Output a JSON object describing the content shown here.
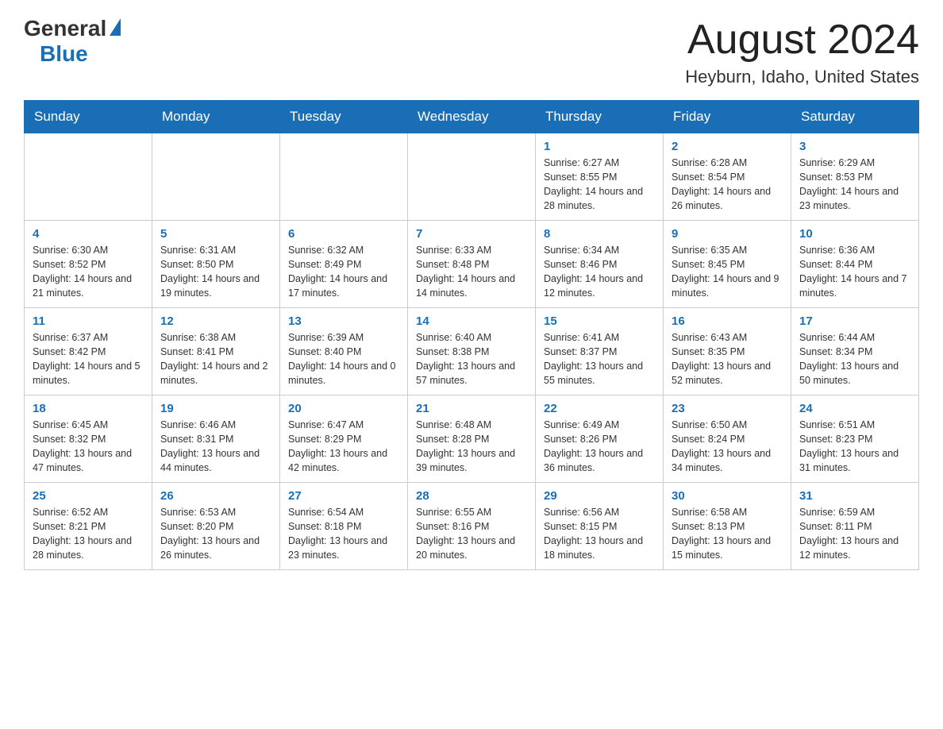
{
  "header": {
    "logo_general": "General",
    "logo_blue": "Blue",
    "month_title": "August 2024",
    "location": "Heyburn, Idaho, United States"
  },
  "weekdays": [
    "Sunday",
    "Monday",
    "Tuesday",
    "Wednesday",
    "Thursday",
    "Friday",
    "Saturday"
  ],
  "weeks": [
    [
      {
        "day": "",
        "info": ""
      },
      {
        "day": "",
        "info": ""
      },
      {
        "day": "",
        "info": ""
      },
      {
        "day": "",
        "info": ""
      },
      {
        "day": "1",
        "info": "Sunrise: 6:27 AM\nSunset: 8:55 PM\nDaylight: 14 hours and 28 minutes."
      },
      {
        "day": "2",
        "info": "Sunrise: 6:28 AM\nSunset: 8:54 PM\nDaylight: 14 hours and 26 minutes."
      },
      {
        "day": "3",
        "info": "Sunrise: 6:29 AM\nSunset: 8:53 PM\nDaylight: 14 hours and 23 minutes."
      }
    ],
    [
      {
        "day": "4",
        "info": "Sunrise: 6:30 AM\nSunset: 8:52 PM\nDaylight: 14 hours and 21 minutes."
      },
      {
        "day": "5",
        "info": "Sunrise: 6:31 AM\nSunset: 8:50 PM\nDaylight: 14 hours and 19 minutes."
      },
      {
        "day": "6",
        "info": "Sunrise: 6:32 AM\nSunset: 8:49 PM\nDaylight: 14 hours and 17 minutes."
      },
      {
        "day": "7",
        "info": "Sunrise: 6:33 AM\nSunset: 8:48 PM\nDaylight: 14 hours and 14 minutes."
      },
      {
        "day": "8",
        "info": "Sunrise: 6:34 AM\nSunset: 8:46 PM\nDaylight: 14 hours and 12 minutes."
      },
      {
        "day": "9",
        "info": "Sunrise: 6:35 AM\nSunset: 8:45 PM\nDaylight: 14 hours and 9 minutes."
      },
      {
        "day": "10",
        "info": "Sunrise: 6:36 AM\nSunset: 8:44 PM\nDaylight: 14 hours and 7 minutes."
      }
    ],
    [
      {
        "day": "11",
        "info": "Sunrise: 6:37 AM\nSunset: 8:42 PM\nDaylight: 14 hours and 5 minutes."
      },
      {
        "day": "12",
        "info": "Sunrise: 6:38 AM\nSunset: 8:41 PM\nDaylight: 14 hours and 2 minutes."
      },
      {
        "day": "13",
        "info": "Sunrise: 6:39 AM\nSunset: 8:40 PM\nDaylight: 14 hours and 0 minutes."
      },
      {
        "day": "14",
        "info": "Sunrise: 6:40 AM\nSunset: 8:38 PM\nDaylight: 13 hours and 57 minutes."
      },
      {
        "day": "15",
        "info": "Sunrise: 6:41 AM\nSunset: 8:37 PM\nDaylight: 13 hours and 55 minutes."
      },
      {
        "day": "16",
        "info": "Sunrise: 6:43 AM\nSunset: 8:35 PM\nDaylight: 13 hours and 52 minutes."
      },
      {
        "day": "17",
        "info": "Sunrise: 6:44 AM\nSunset: 8:34 PM\nDaylight: 13 hours and 50 minutes."
      }
    ],
    [
      {
        "day": "18",
        "info": "Sunrise: 6:45 AM\nSunset: 8:32 PM\nDaylight: 13 hours and 47 minutes."
      },
      {
        "day": "19",
        "info": "Sunrise: 6:46 AM\nSunset: 8:31 PM\nDaylight: 13 hours and 44 minutes."
      },
      {
        "day": "20",
        "info": "Sunrise: 6:47 AM\nSunset: 8:29 PM\nDaylight: 13 hours and 42 minutes."
      },
      {
        "day": "21",
        "info": "Sunrise: 6:48 AM\nSunset: 8:28 PM\nDaylight: 13 hours and 39 minutes."
      },
      {
        "day": "22",
        "info": "Sunrise: 6:49 AM\nSunset: 8:26 PM\nDaylight: 13 hours and 36 minutes."
      },
      {
        "day": "23",
        "info": "Sunrise: 6:50 AM\nSunset: 8:24 PM\nDaylight: 13 hours and 34 minutes."
      },
      {
        "day": "24",
        "info": "Sunrise: 6:51 AM\nSunset: 8:23 PM\nDaylight: 13 hours and 31 minutes."
      }
    ],
    [
      {
        "day": "25",
        "info": "Sunrise: 6:52 AM\nSunset: 8:21 PM\nDaylight: 13 hours and 28 minutes."
      },
      {
        "day": "26",
        "info": "Sunrise: 6:53 AM\nSunset: 8:20 PM\nDaylight: 13 hours and 26 minutes."
      },
      {
        "day": "27",
        "info": "Sunrise: 6:54 AM\nSunset: 8:18 PM\nDaylight: 13 hours and 23 minutes."
      },
      {
        "day": "28",
        "info": "Sunrise: 6:55 AM\nSunset: 8:16 PM\nDaylight: 13 hours and 20 minutes."
      },
      {
        "day": "29",
        "info": "Sunrise: 6:56 AM\nSunset: 8:15 PM\nDaylight: 13 hours and 18 minutes."
      },
      {
        "day": "30",
        "info": "Sunrise: 6:58 AM\nSunset: 8:13 PM\nDaylight: 13 hours and 15 minutes."
      },
      {
        "day": "31",
        "info": "Sunrise: 6:59 AM\nSunset: 8:11 PM\nDaylight: 13 hours and 12 minutes."
      }
    ]
  ]
}
